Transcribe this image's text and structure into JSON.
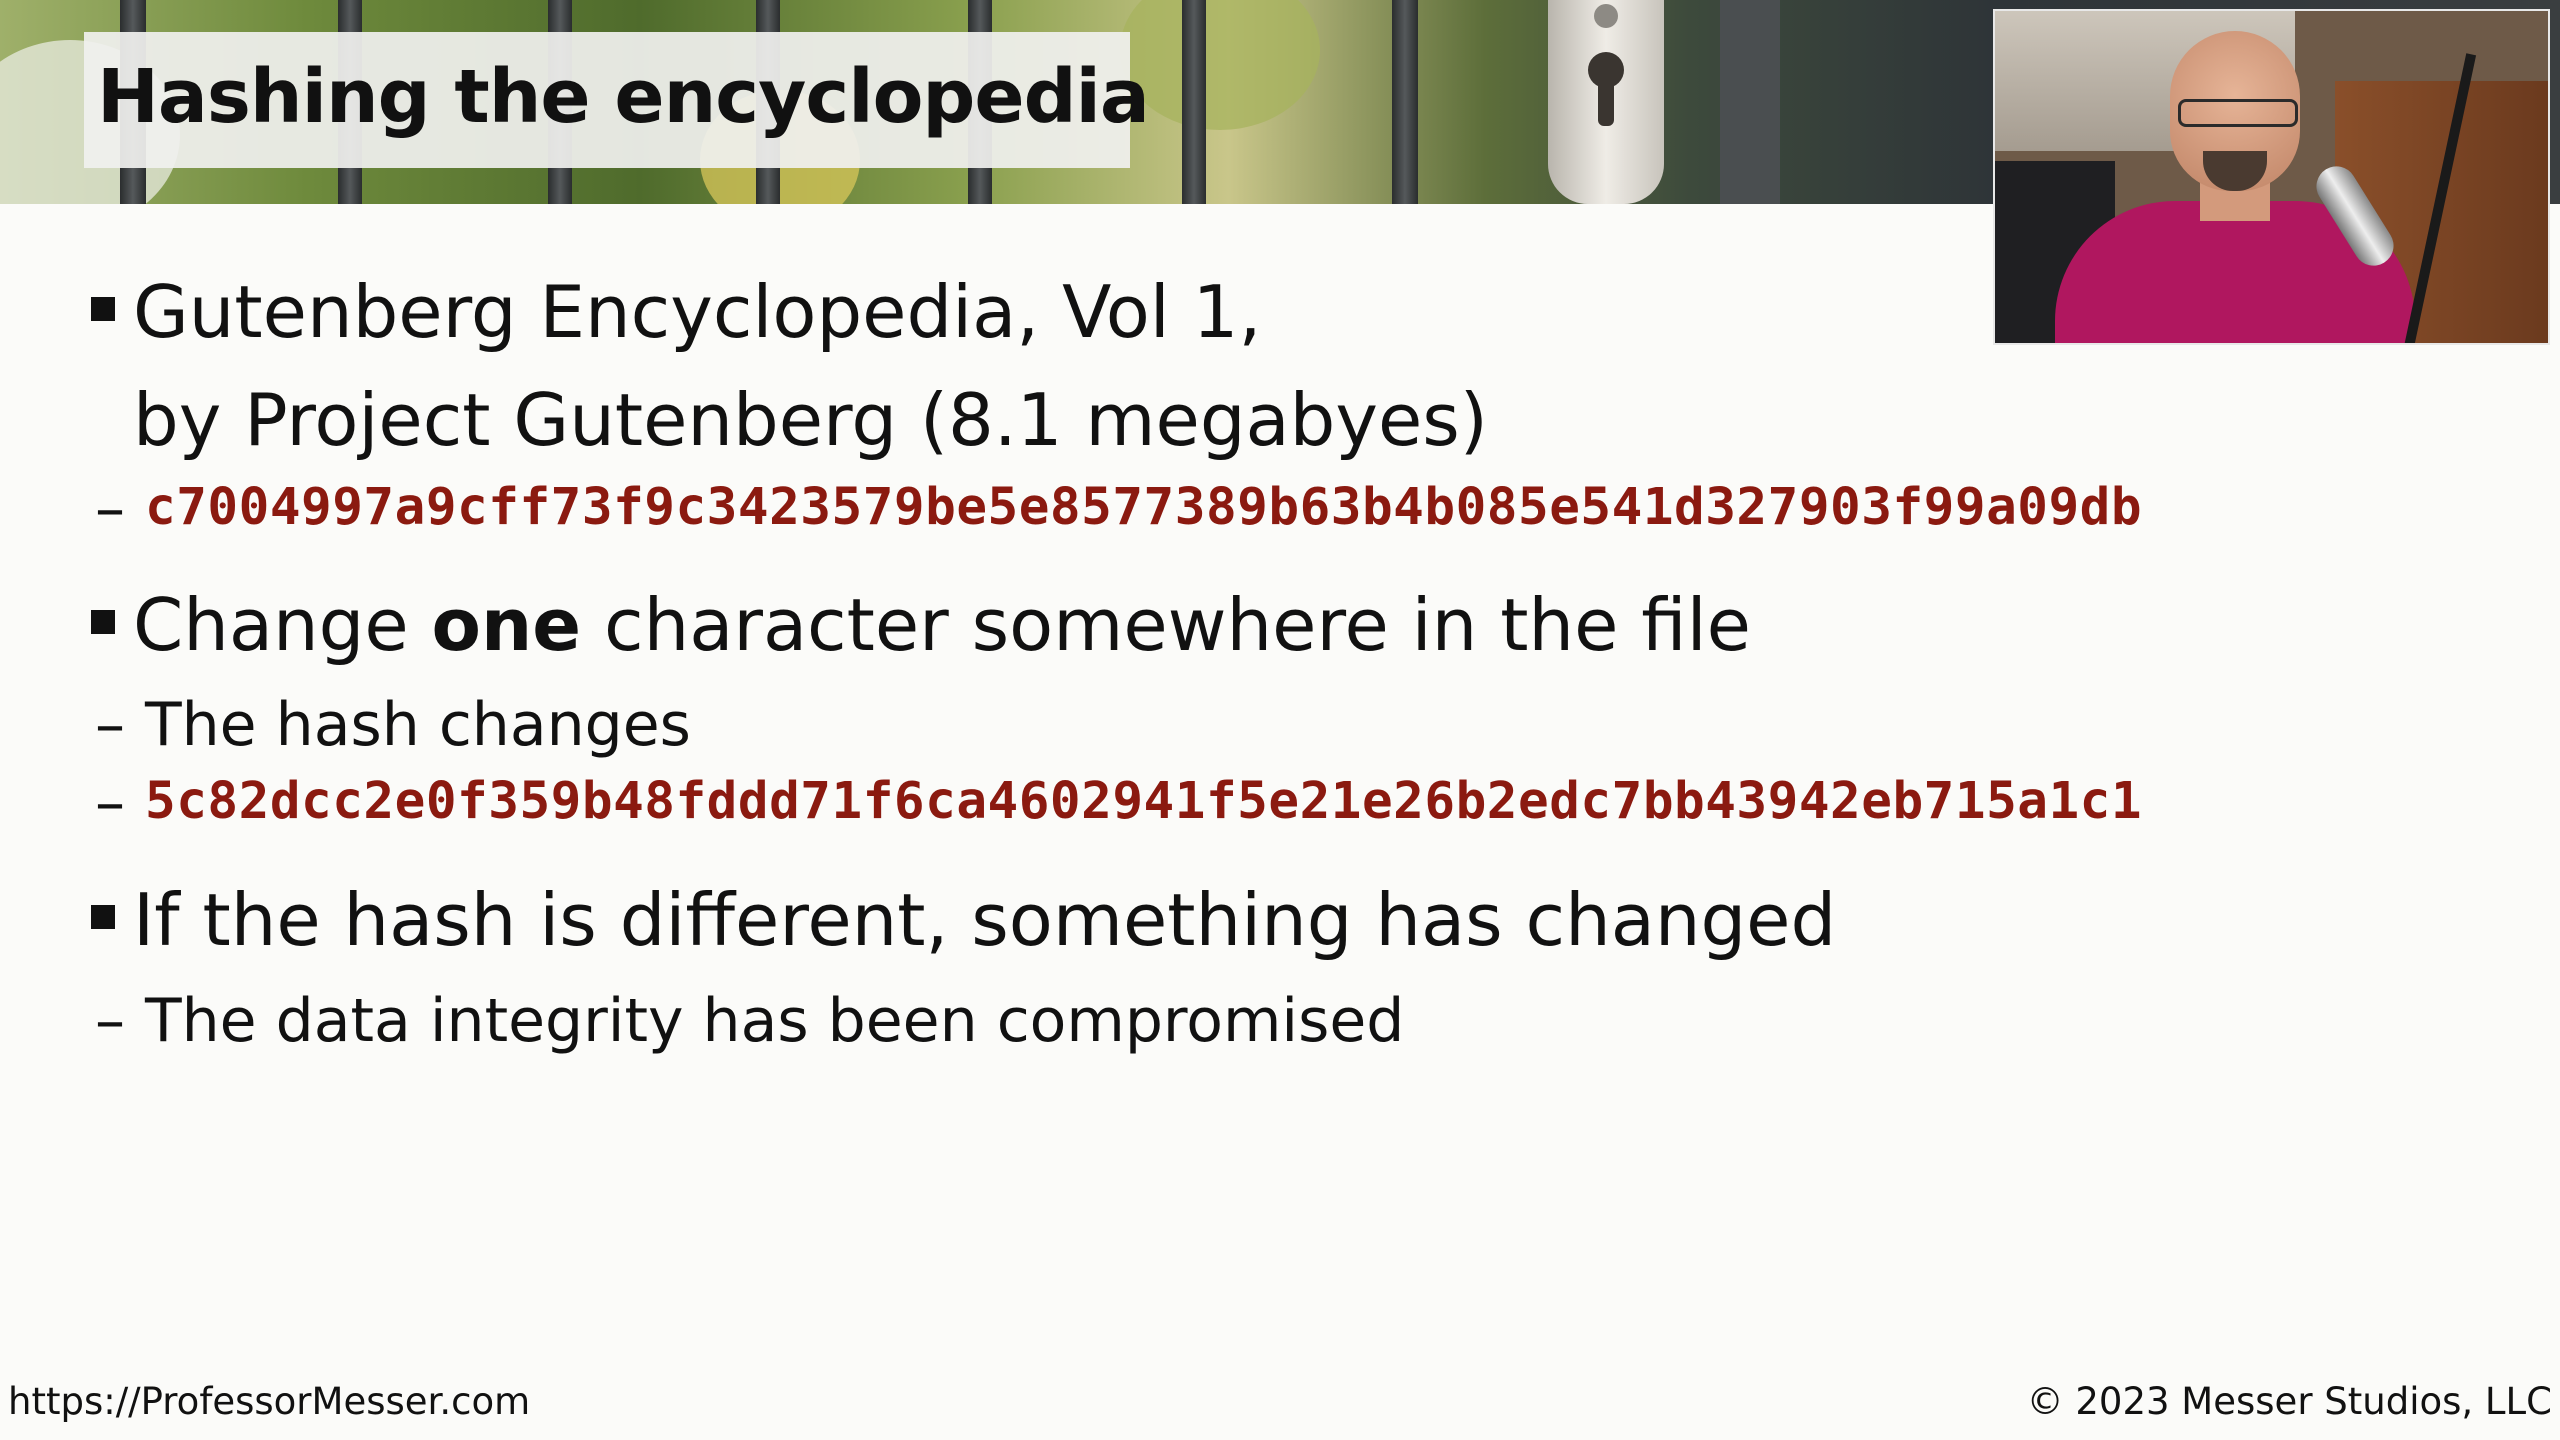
{
  "slide": {
    "title": "Hashing the encyclopedia",
    "bullets": [
      {
        "line1": "Gutenberg Encyclopedia, Vol 1,",
        "line2": "by Project Gutenberg (8.1 megabyes)",
        "hash": "c7004997a9cff73f9c3423579be5e8577389b63b4b085e541d327903f99a09db"
      },
      {
        "pre": "Change ",
        "bold": "one",
        "post": " character somewhere in the file",
        "sub": "The hash changes",
        "hash": "5c82dcc2e0f359b48fddd71f6ca4602941f5e21e26b2edc7bb43942eb715a1c1"
      },
      {
        "text": "If the hash is different, something has changed",
        "sub": "The data integrity has been compromised"
      }
    ],
    "dash": "–"
  },
  "footer": {
    "url": "https://ProfessorMesser.com",
    "copyright": "© 2023 Messer Studios, LLC"
  },
  "colors": {
    "hash": "#8b1a10",
    "background": "#fbfbf9",
    "text": "#111111"
  }
}
